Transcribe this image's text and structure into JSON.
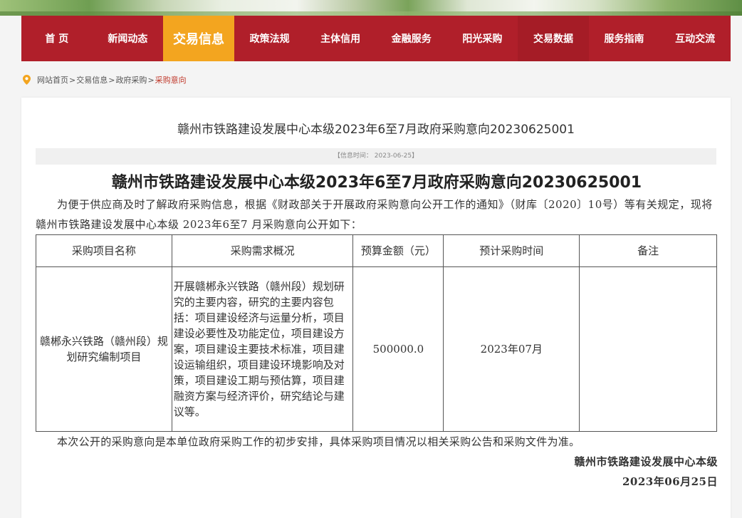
{
  "nav": {
    "items": [
      "首 页",
      "新闻动态",
      "交易信息",
      "政策法规",
      "主体信用",
      "金融服务",
      "阳光采购",
      "交易数据",
      "服务指南",
      "互动交流"
    ],
    "active_index": 2,
    "colors": {
      "bar": "#b01f2a",
      "active": "#f3a51f"
    }
  },
  "breadcrumb": {
    "icon": "location-pin-icon",
    "items": [
      "网站首页",
      "交易信息",
      "政府采购",
      "采购意向"
    ],
    "separator": ">"
  },
  "article": {
    "title": "赣州市铁路建设发展中心本级2023年6至7月政府采购意向20230625001",
    "info": "【信息时间： 2023-06-25】",
    "heading": "赣州市铁路建设发展中心本级2023年6至7月政府采购意向20230625001",
    "intro": "为便于供应商及时了解政府采购信息，根据《财政部关于开展政府采购意向公开工作的通知》（财库〔2020〕10号）等有关规定，现将 赣州市铁路建设发展中心本级 2023年6至7 月采购意向公开如下：",
    "table": {
      "headers": [
        "采购项目名称",
        "采购需求概况",
        "预算金额（元）",
        "预计采购时间",
        "备注"
      ],
      "rows": [
        {
          "name": "赣郴永兴铁路（赣州段）规划研究编制项目",
          "requirement": "开展赣郴永兴铁路（赣州段）规划研究的主要内容，研究的主要内容包括：项目建设经济与运量分析，项目建设必要性及功能定位，项目建设方案，项目建设主要技术标准，项目建设运输组织，项目建设环境影响及对策，项目建设工期与预估算，项目建融资方案与经济评价，研究结论与建议等。",
          "budget": "500000.0",
          "time": "2023年07月",
          "remark": ""
        }
      ]
    },
    "footer_note": "本次公开的采购意向是本单位政府采购工作的初步安排，具体采购项目情况以相关采购公告和采购文件为准。",
    "signature": "赣州市铁路建设发展中心本级",
    "date": "2023年06月25日"
  }
}
